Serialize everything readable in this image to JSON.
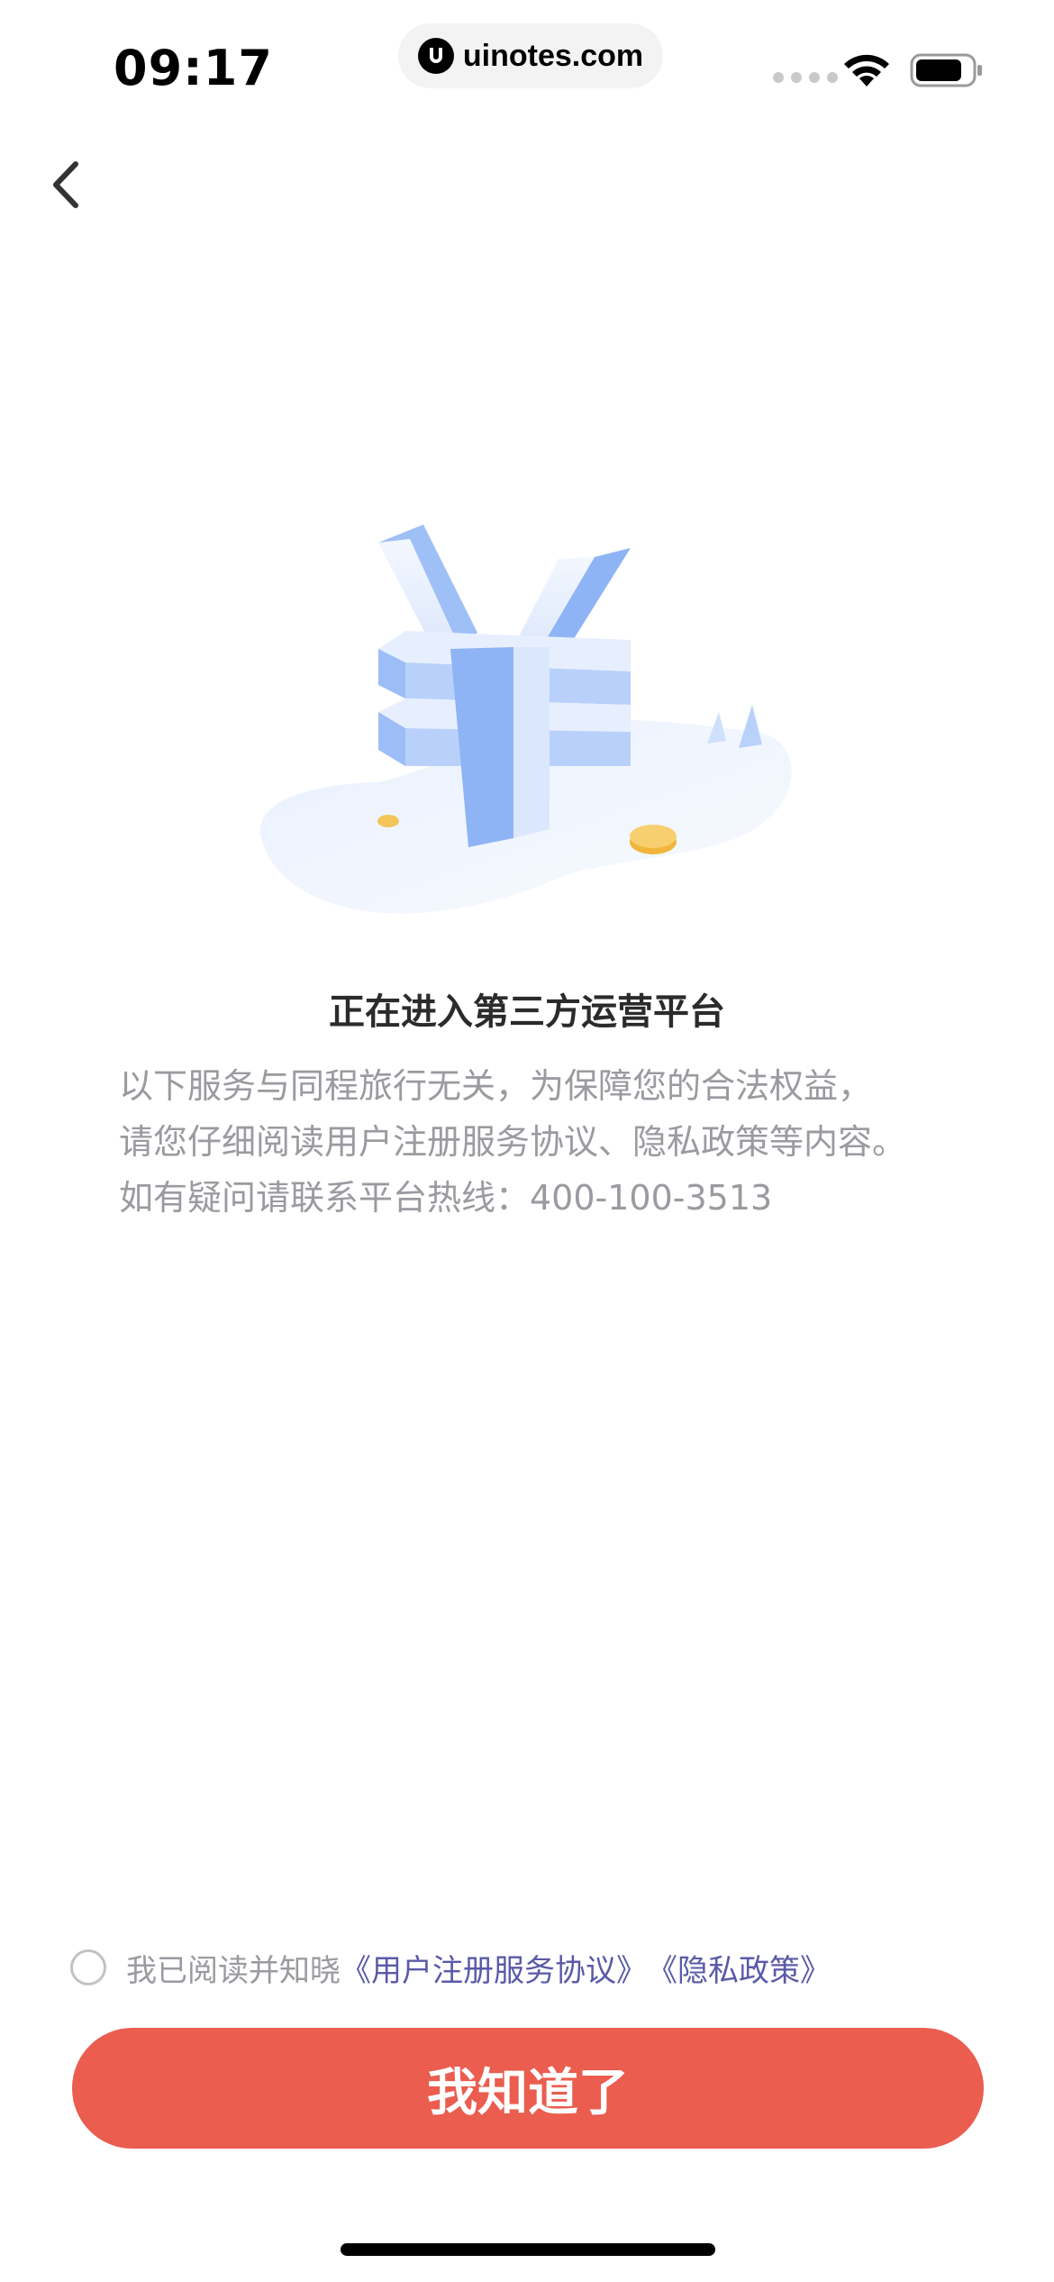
{
  "status_bar": {
    "time": "09:17",
    "url": "uinotes.com"
  },
  "nav": {
    "back_icon": "chevron-left-icon"
  },
  "content": {
    "title": "正在进入第三方运营平台",
    "lines": [
      "以下服务与同程旅行无关，为保障您的合法权益，",
      "请您仔细阅读用户注册服务协议、隐私政策等内容。",
      "如有疑问请联系平台热线：400-100-3513"
    ]
  },
  "agreement": {
    "prefix": "我已阅读并知晓",
    "link_register": "《用户注册服务协议》",
    "link_privacy": "《隐私政策》"
  },
  "button": {
    "label": "我知道了"
  },
  "colors": {
    "accent": "#ea5d4f",
    "link": "#5a5aa8",
    "muted_text": "#9a9aa0",
    "illustration_blue": "#8fb8f5"
  }
}
